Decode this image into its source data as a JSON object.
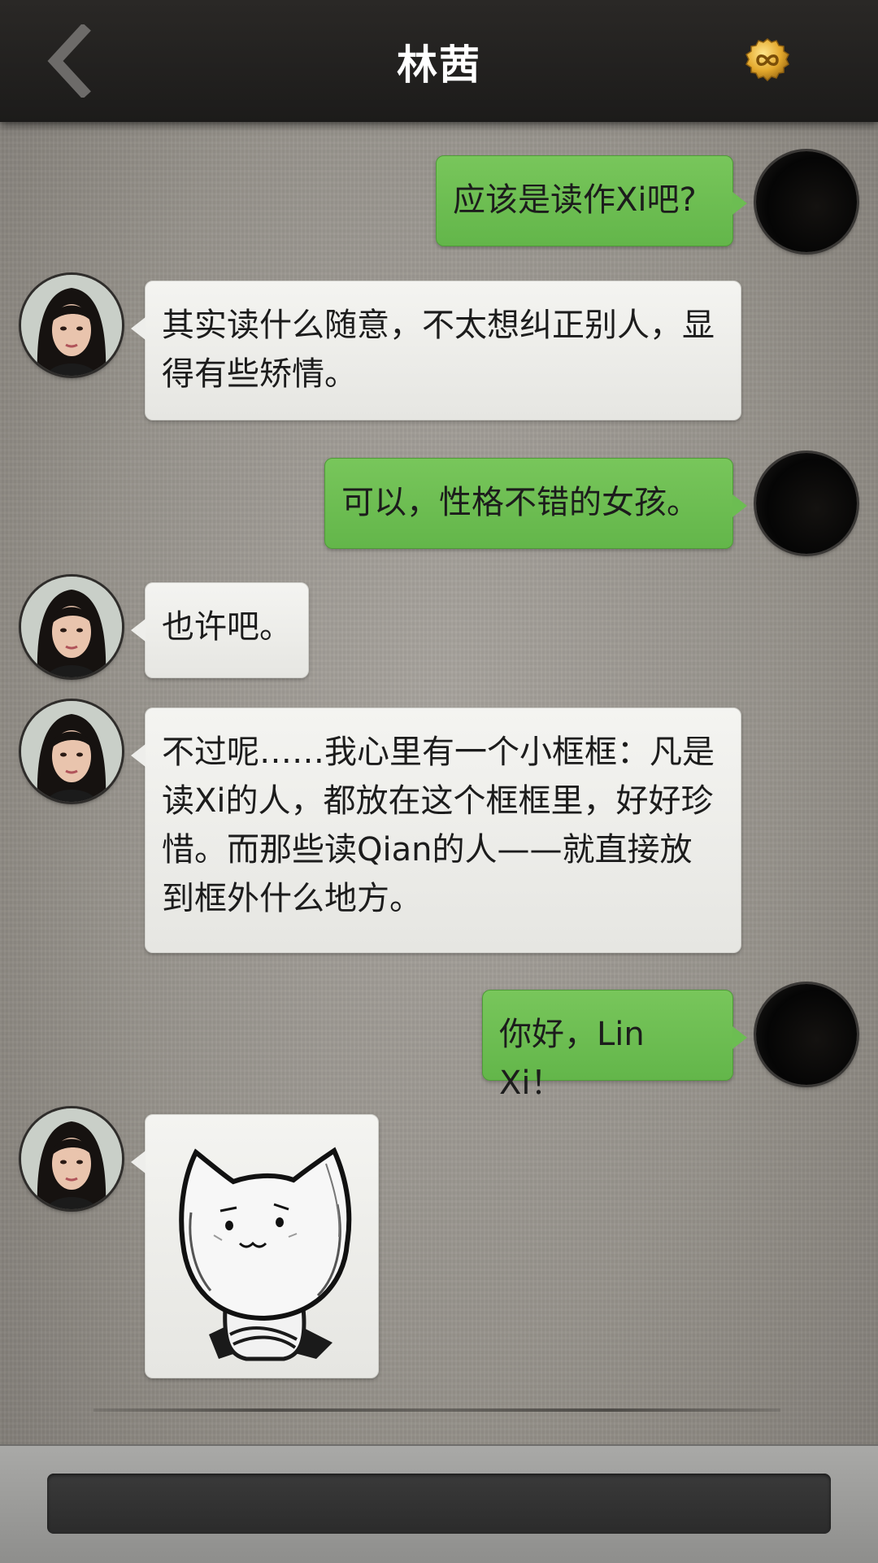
{
  "header": {
    "title": "林茜",
    "back_icon": "chevron-left-icon",
    "coin_icon": "infinity-coin-icon"
  },
  "messages": [
    {
      "side": "right",
      "text": "应该是读作Xi吧?"
    },
    {
      "side": "left",
      "text": "其实读什么随意，不太想纠正别人，显得有些矫情。"
    },
    {
      "side": "right",
      "text": "可以，性格不错的女孩。"
    },
    {
      "side": "left",
      "text": "也许吧。"
    },
    {
      "side": "left",
      "text": "不过呢……我心里有一个小框框：凡是读Xi的人，都放在这个框框里，好好珍惜。而那些读Qian的人——就直接放到框外什么地方。"
    },
    {
      "side": "right",
      "text": "你好，Lin Xi！"
    },
    {
      "side": "left",
      "sticker": "cat-sticker"
    }
  ],
  "input": {
    "value": ""
  },
  "colors": {
    "header_bg": "#1c1b1a",
    "bubble_right": "#6cbd52",
    "bubble_left": "#eeeeeb",
    "input_bg": "#2f2f2f"
  }
}
